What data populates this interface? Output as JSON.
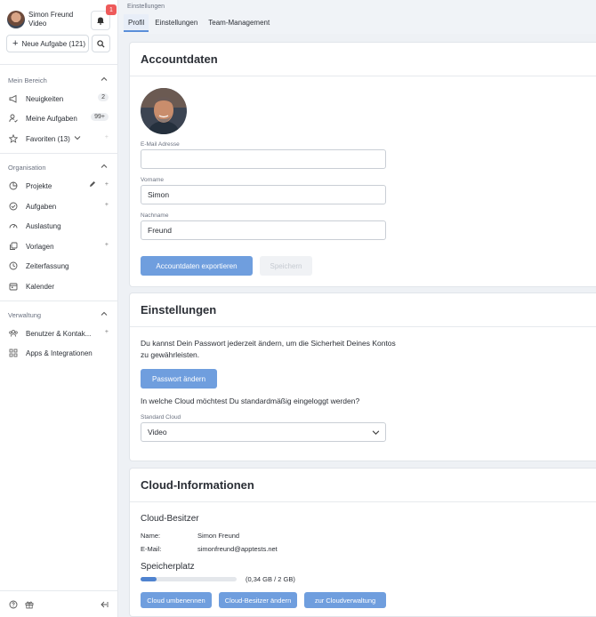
{
  "user": {
    "name": "Simon Freund",
    "subtitle": "Video",
    "notification_count": "1"
  },
  "sidebar": {
    "new_task_label": "Neue Aufgabe (121)",
    "sections": [
      {
        "title": "Mein Bereich"
      },
      {
        "title": "Organisation"
      },
      {
        "title": "Verwaltung"
      }
    ],
    "mein_bereich": [
      {
        "label": "Neuigkeiten",
        "icon": "megaphone-icon",
        "badge": "2"
      },
      {
        "label": "Meine Aufgaben",
        "icon": "user-check-icon",
        "badge": "99+"
      },
      {
        "label": "Favoriten (13)",
        "icon": "star-icon"
      }
    ],
    "organisation": [
      {
        "label": "Projekte",
        "icon": "pie-chart-icon"
      },
      {
        "label": "Aufgaben",
        "icon": "check-circle-icon"
      },
      {
        "label": "Auslastung",
        "icon": "gauge-icon"
      },
      {
        "label": "Vorlagen",
        "icon": "copy-icon"
      },
      {
        "label": "Zeiterfassung",
        "icon": "clock-icon"
      },
      {
        "label": "Kalender",
        "icon": "calendar-icon"
      }
    ],
    "verwaltung": [
      {
        "label": "Benutzer & Kontak...",
        "icon": "users-icon"
      },
      {
        "label": "Apps & Integrationen",
        "icon": "apps-icon"
      }
    ]
  },
  "breadcrumb": "Einstellungen",
  "tabs": [
    {
      "label": "Profil",
      "active": true
    },
    {
      "label": "Einstellungen"
    },
    {
      "label": "Team-Management"
    }
  ],
  "account": {
    "title": "Accountdaten",
    "email_label": "E-Mail Adresse",
    "email_value": "",
    "firstname_label": "Vorname",
    "firstname_value": "Simon",
    "lastname_label": "Nachname",
    "lastname_value": "Freund",
    "export_button": "Accountdaten exportieren",
    "save_button": "Speichern"
  },
  "settings": {
    "title": "Einstellungen",
    "password_text": "Du kannst Dein Passwort jederzeit ändern, um die Sicherheit Deines Kontos zu gewährleisten.",
    "password_button": "Passwort ändern",
    "cloud_question": "In welche Cloud möchtest Du standardmäßig eingeloggt werden?",
    "cloud_label": "Standard Cloud",
    "cloud_value": "Video"
  },
  "cloud": {
    "title": "Cloud-Informationen",
    "owner_heading": "Cloud-Besitzer",
    "name_label": "Name:",
    "name_value": "Simon Freund",
    "email_label": "E-Mail:",
    "email_value": "simonfreund@apptests.net",
    "storage_heading": "Speicherplatz",
    "storage_text": "(0,34 GB / 2 GB)",
    "storage_fraction": 0.17,
    "rename_button": "Cloud umbenennen",
    "change_owner_button": "Cloud-Besitzer ändern",
    "admin_button": "zur Cloudverwaltung"
  },
  "colors": {
    "accent": "#6f9ede",
    "badge": "#ee5a5a"
  }
}
